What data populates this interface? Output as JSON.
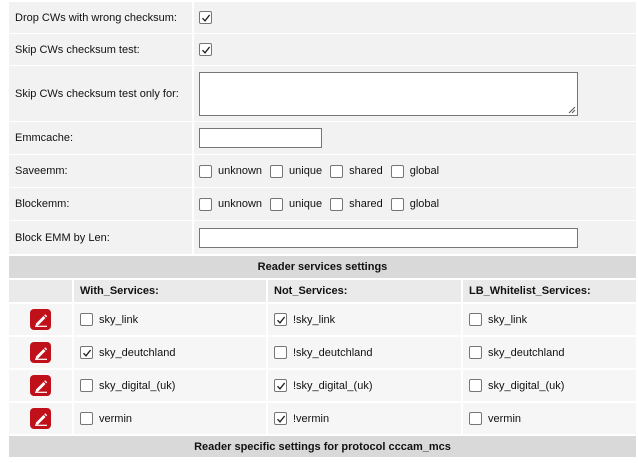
{
  "settings": {
    "drop_cws": {
      "label": "Drop CWs with wrong checksum:",
      "checked": true
    },
    "skip_cws": {
      "label": "Skip CWs checksum test:",
      "checked": true
    },
    "skip_only_for": {
      "label": "Skip CWs checksum test only for:",
      "value": ""
    },
    "emmcache": {
      "label": "Emmcache:",
      "value": ""
    },
    "saveemm": {
      "label": "Saveemm:",
      "options": [
        {
          "label": "unknown",
          "checked": false
        },
        {
          "label": "unique",
          "checked": false
        },
        {
          "label": "shared",
          "checked": false
        },
        {
          "label": "global",
          "checked": false
        }
      ]
    },
    "blockemm": {
      "label": "Blockemm:",
      "options": [
        {
          "label": "unknown",
          "checked": false
        },
        {
          "label": "unique",
          "checked": false
        },
        {
          "label": "shared",
          "checked": false
        },
        {
          "label": "global",
          "checked": false
        }
      ]
    },
    "blockemm_len": {
      "label": "Block EMM by Len:",
      "value": ""
    }
  },
  "services": {
    "section_title": "Reader services settings",
    "headers": [
      "With_Services:",
      "Not_Services:",
      "LB_Whitelist_Services:"
    ],
    "rows": [
      {
        "with": {
          "label": "sky_link",
          "checked": false
        },
        "not": {
          "label": "!sky_link",
          "checked": true
        },
        "lb": {
          "label": "sky_link",
          "checked": false
        }
      },
      {
        "with": {
          "label": "sky_deutchland",
          "checked": true
        },
        "not": {
          "label": "!sky_deutchland",
          "checked": false
        },
        "lb": {
          "label": "sky_deutchland",
          "checked": false
        }
      },
      {
        "with": {
          "label": "sky_digital_(uk)",
          "checked": false
        },
        "not": {
          "label": "!sky_digital_(uk)",
          "checked": true
        },
        "lb": {
          "label": "sky_digital_(uk)",
          "checked": false
        }
      },
      {
        "with": {
          "label": "vermin",
          "checked": false
        },
        "not": {
          "label": "!vermin",
          "checked": true
        },
        "lb": {
          "label": "vermin",
          "checked": false
        }
      }
    ],
    "edit_icon": "pencil-edit-icon",
    "edit_color": "#c0111a"
  },
  "protocol_section_title": "Reader specific settings for protocol cccam_mcs"
}
